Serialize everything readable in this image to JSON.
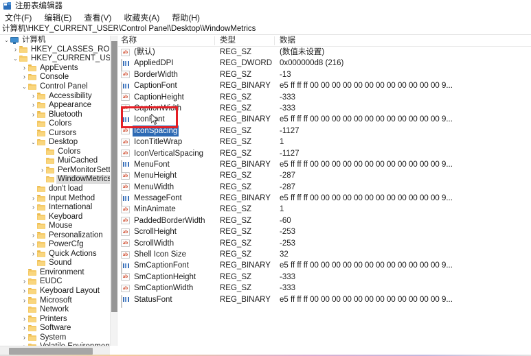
{
  "window": {
    "title": "注册表编辑器",
    "icon": "registry-editor-icon"
  },
  "menu": [
    {
      "label": "文件(F)"
    },
    {
      "label": "编辑(E)"
    },
    {
      "label": "查看(V)"
    },
    {
      "label": "收藏夹(A)"
    },
    {
      "label": "帮助(H)"
    }
  ],
  "address": {
    "path": "计算机\\HKEY_CURRENT_USER\\Control Panel\\Desktop\\WindowMetrics"
  },
  "tree": {
    "items": [
      {
        "label": "计算机",
        "indent": 0,
        "chev": "down",
        "icon": "computer-icon",
        "selected": false
      },
      {
        "label": "HKEY_CLASSES_ROOT",
        "indent": 1,
        "chev": "right",
        "icon": "folder-icon",
        "selected": false
      },
      {
        "label": "HKEY_CURRENT_USER",
        "indent": 1,
        "chev": "down",
        "icon": "folder-icon",
        "selected": false
      },
      {
        "label": "AppEvents",
        "indent": 2,
        "chev": "right",
        "icon": "folder-icon",
        "selected": false
      },
      {
        "label": "Console",
        "indent": 2,
        "chev": "right",
        "icon": "folder-icon",
        "selected": false
      },
      {
        "label": "Control Panel",
        "indent": 2,
        "chev": "down",
        "icon": "folder-icon",
        "selected": false
      },
      {
        "label": "Accessibility",
        "indent": 3,
        "chev": "right",
        "icon": "folder-icon",
        "selected": false
      },
      {
        "label": "Appearance",
        "indent": 3,
        "chev": "right",
        "icon": "folder-icon",
        "selected": false
      },
      {
        "label": "Bluetooth",
        "indent": 3,
        "chev": "right",
        "icon": "folder-icon",
        "selected": false
      },
      {
        "label": "Colors",
        "indent": 3,
        "chev": "none",
        "icon": "folder-icon",
        "selected": false
      },
      {
        "label": "Cursors",
        "indent": 3,
        "chev": "none",
        "icon": "folder-icon",
        "selected": false
      },
      {
        "label": "Desktop",
        "indent": 3,
        "chev": "down",
        "icon": "folder-icon",
        "selected": false
      },
      {
        "label": "Colors",
        "indent": 4,
        "chev": "none",
        "icon": "folder-icon",
        "selected": false
      },
      {
        "label": "MuiCached",
        "indent": 4,
        "chev": "none",
        "icon": "folder-icon",
        "selected": false
      },
      {
        "label": "PerMonitorSettin",
        "indent": 4,
        "chev": "right",
        "icon": "folder-icon",
        "selected": false
      },
      {
        "label": "WindowMetrics",
        "indent": 4,
        "chev": "none",
        "icon": "folder-icon",
        "selected": true
      },
      {
        "label": "don't load",
        "indent": 3,
        "chev": "none",
        "icon": "folder-icon",
        "selected": false
      },
      {
        "label": "Input Method",
        "indent": 3,
        "chev": "right",
        "icon": "folder-icon",
        "selected": false
      },
      {
        "label": "International",
        "indent": 3,
        "chev": "right",
        "icon": "folder-icon",
        "selected": false
      },
      {
        "label": "Keyboard",
        "indent": 3,
        "chev": "none",
        "icon": "folder-icon",
        "selected": false
      },
      {
        "label": "Mouse",
        "indent": 3,
        "chev": "none",
        "icon": "folder-icon",
        "selected": false
      },
      {
        "label": "Personalization",
        "indent": 3,
        "chev": "right",
        "icon": "folder-icon",
        "selected": false
      },
      {
        "label": "PowerCfg",
        "indent": 3,
        "chev": "right",
        "icon": "folder-icon",
        "selected": false
      },
      {
        "label": "Quick Actions",
        "indent": 3,
        "chev": "right",
        "icon": "folder-icon",
        "selected": false
      },
      {
        "label": "Sound",
        "indent": 3,
        "chev": "none",
        "icon": "folder-icon",
        "selected": false
      },
      {
        "label": "Environment",
        "indent": 2,
        "chev": "none",
        "icon": "folder-icon",
        "selected": false
      },
      {
        "label": "EUDC",
        "indent": 2,
        "chev": "right",
        "icon": "folder-icon",
        "selected": false
      },
      {
        "label": "Keyboard Layout",
        "indent": 2,
        "chev": "right",
        "icon": "folder-icon",
        "selected": false
      },
      {
        "label": "Microsoft",
        "indent": 2,
        "chev": "right",
        "icon": "folder-icon",
        "selected": false
      },
      {
        "label": "Network",
        "indent": 2,
        "chev": "none",
        "icon": "folder-icon",
        "selected": false
      },
      {
        "label": "Printers",
        "indent": 2,
        "chev": "right",
        "icon": "folder-icon",
        "selected": false
      },
      {
        "label": "Software",
        "indent": 2,
        "chev": "right",
        "icon": "folder-icon",
        "selected": false
      },
      {
        "label": "System",
        "indent": 2,
        "chev": "right",
        "icon": "folder-icon",
        "selected": false
      },
      {
        "label": "Volatile Environment",
        "indent": 2,
        "chev": "right",
        "icon": "folder-icon",
        "selected": false
      }
    ]
  },
  "list": {
    "columns": [
      "名称",
      "类型",
      "数据"
    ],
    "rows": [
      {
        "name": "(默认)",
        "type": "REG_SZ",
        "data": "(数值未设置)",
        "icon": "string-value-icon",
        "selected": false
      },
      {
        "name": "AppliedDPI",
        "type": "REG_DWORD",
        "data": "0x000000d8 (216)",
        "icon": "binary-value-icon",
        "selected": false
      },
      {
        "name": "BorderWidth",
        "type": "REG_SZ",
        "data": "-13",
        "icon": "string-value-icon",
        "selected": false
      },
      {
        "name": "CaptionFont",
        "type": "REG_BINARY",
        "data": "e5 ff ff ff 00 00 00 00 00 00 00 00 00 00 00 00 9...",
        "icon": "binary-value-icon",
        "selected": false
      },
      {
        "name": "CaptionHeight",
        "type": "REG_SZ",
        "data": "-333",
        "icon": "string-value-icon",
        "selected": false
      },
      {
        "name": "CaptionWidth",
        "type": "REG_SZ",
        "data": "-333",
        "icon": "string-value-icon",
        "selected": false
      },
      {
        "name": "IconFont",
        "type": "REG_BINARY",
        "data": "e5 ff ff ff 00 00 00 00 00 00 00 00 00 00 00 00 9...",
        "icon": "binary-value-icon",
        "selected": false
      },
      {
        "name": "IconSpacing",
        "type": "REG_SZ",
        "data": "-1127",
        "icon": "string-value-icon",
        "selected": true
      },
      {
        "name": "IconTitleWrap",
        "type": "REG_SZ",
        "data": "1",
        "icon": "string-value-icon",
        "selected": false
      },
      {
        "name": "IconVerticalSpacing",
        "type": "REG_SZ",
        "data": "-1127",
        "icon": "string-value-icon",
        "selected": false
      },
      {
        "name": "MenuFont",
        "type": "REG_BINARY",
        "data": "e5 ff ff ff 00 00 00 00 00 00 00 00 00 00 00 00 9...",
        "icon": "binary-value-icon",
        "selected": false
      },
      {
        "name": "MenuHeight",
        "type": "REG_SZ",
        "data": "-287",
        "icon": "string-value-icon",
        "selected": false
      },
      {
        "name": "MenuWidth",
        "type": "REG_SZ",
        "data": "-287",
        "icon": "string-value-icon",
        "selected": false
      },
      {
        "name": "MessageFont",
        "type": "REG_BINARY",
        "data": "e5 ff ff ff 00 00 00 00 00 00 00 00 00 00 00 00 9...",
        "icon": "binary-value-icon",
        "selected": false
      },
      {
        "name": "MinAnimate",
        "type": "REG_SZ",
        "data": "1",
        "icon": "string-value-icon",
        "selected": false
      },
      {
        "name": "PaddedBorderWidth",
        "type": "REG_SZ",
        "data": "-60",
        "icon": "string-value-icon",
        "selected": false
      },
      {
        "name": "ScrollHeight",
        "type": "REG_SZ",
        "data": "-253",
        "icon": "string-value-icon",
        "selected": false
      },
      {
        "name": "ScrollWidth",
        "type": "REG_SZ",
        "data": "-253",
        "icon": "string-value-icon",
        "selected": false
      },
      {
        "name": "Shell Icon Size",
        "type": "REG_SZ",
        "data": "32",
        "icon": "string-value-icon",
        "selected": false
      },
      {
        "name": "SmCaptionFont",
        "type": "REG_BINARY",
        "data": "e5 ff ff ff 00 00 00 00 00 00 00 00 00 00 00 00 9...",
        "icon": "binary-value-icon",
        "selected": false
      },
      {
        "name": "SmCaptionHeight",
        "type": "REG_SZ",
        "data": "-333",
        "icon": "string-value-icon",
        "selected": false
      },
      {
        "name": "SmCaptionWidth",
        "type": "REG_SZ",
        "data": "-333",
        "icon": "string-value-icon",
        "selected": false
      },
      {
        "name": "StatusFont",
        "type": "REG_BINARY",
        "data": "e5 ff ff ff 00 00 00 00 00 00 00 00 00 00 00 00 9...",
        "icon": "binary-value-icon",
        "selected": false
      }
    ]
  },
  "annotation": {
    "color": "#e41f26",
    "target": "IconSpacing"
  },
  "icon_text": {
    "string_value": "ab"
  }
}
